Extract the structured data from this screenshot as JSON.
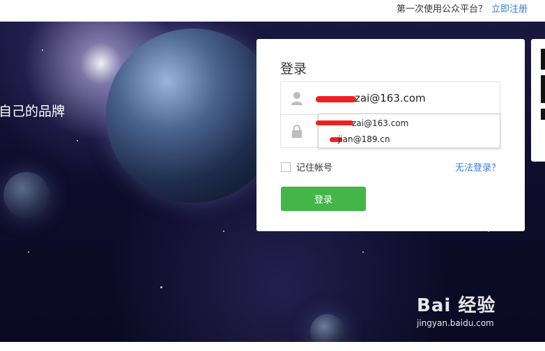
{
  "topbar": {
    "promo_text": "第一次使用公众平台？",
    "register_link": "立即注册"
  },
  "hero": {
    "slogan": "自己的品牌"
  },
  "login": {
    "title": "登录",
    "account_value": "zai@163.com",
    "suggestions": [
      "zai@163.com",
      "jian@189.cn"
    ],
    "remember_label": "记住帐号",
    "cant_login_link": "无法登录？",
    "submit_label": "登录"
  },
  "watermark": {
    "logo": "Bai 经验",
    "url": "jingyan.baidu.com"
  },
  "colors": {
    "accent_green": "#44b549",
    "link_blue": "#3a7bd5"
  }
}
